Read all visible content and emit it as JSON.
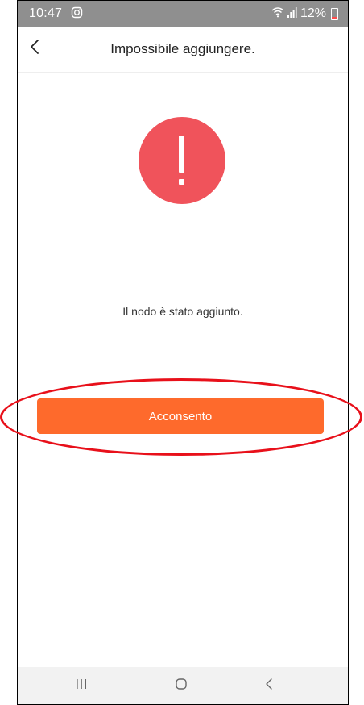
{
  "status_bar": {
    "time": "10:47",
    "notification_icon": "instagram-icon",
    "wifi_icon": "wifi-icon",
    "signal_icon": "signal-icon",
    "battery": "12%",
    "battery_icon": "battery-icon"
  },
  "header": {
    "back_icon": "chevron-left-icon",
    "title": "Impossibile aggiungere."
  },
  "main": {
    "alert_icon": "exclamation-icon",
    "alert_color": "#f0535b",
    "message": "Il nodo è stato aggiunto.",
    "button_label": "Acconsento",
    "button_color": "#fe6a2c"
  },
  "nav_bar": {
    "recents_icon": "recents-icon",
    "home_icon": "home-icon",
    "back_icon": "back-icon"
  },
  "annotation": {
    "color": "#e8101a"
  }
}
